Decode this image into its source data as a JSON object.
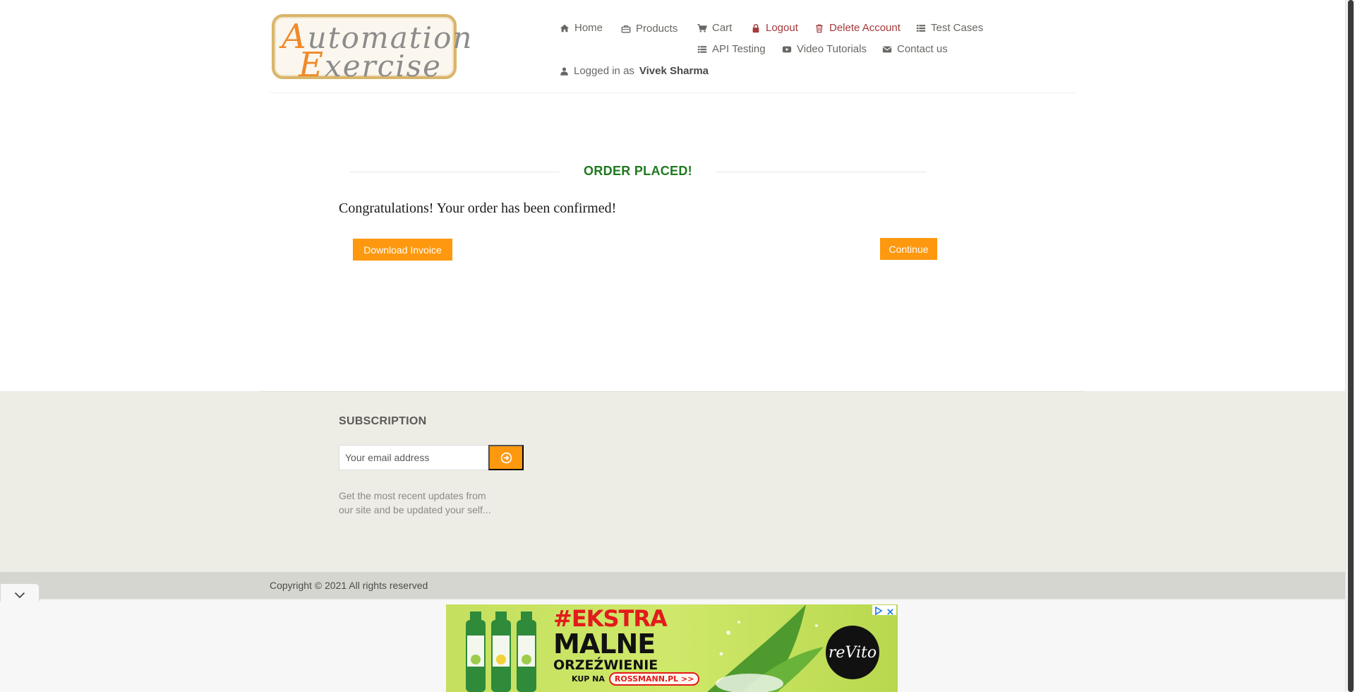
{
  "logo": {
    "line1_cap": "A",
    "line1_rest": "utomation",
    "line2_cap": "E",
    "line2_rest": "xercise"
  },
  "nav": {
    "home": "Home",
    "products": "Products",
    "cart": "Cart",
    "logout": "Logout",
    "delete_account": "Delete Account",
    "test_cases": "Test Cases",
    "api_testing": "API Testing",
    "video_tutorials": "Video Tutorials",
    "contact_us": "Contact us",
    "logged_in_prefix": "Logged in as",
    "logged_in_user": "Vivek Sharma"
  },
  "order": {
    "title": "ORDER PLACED!",
    "message": "Congratulations! Your order has been confirmed!",
    "download_invoice": "Download Invoice",
    "continue": "Continue"
  },
  "subscription": {
    "title": "SUBSCRIPTION",
    "email_placeholder": "Your email address",
    "description": "Get the most recent updates from our site and be updated your self..."
  },
  "footer": {
    "copyright": "Copyright © 2021 All rights reserved"
  },
  "ad": {
    "headline_1": "#EKSTRA",
    "headline_2": "MALNE",
    "headline_3": "ORZEŹWIENIE",
    "cta_prefix": "KUP NA",
    "cta_link": "ROSSMANN.PL >>",
    "brand": "reVito"
  },
  "colors": {
    "accent": "#fe980f",
    "order_title": "#1f7a1f",
    "danger_link": "#a43a3a",
    "footer_bg": "#edece5"
  },
  "icons": {
    "home": "home-icon",
    "products": "briefcase-icon",
    "cart": "shopping-cart-icon",
    "logout": "lock-icon",
    "delete_account": "trash-icon",
    "test_cases": "list-icon",
    "api_testing": "list-icon",
    "video_tutorials": "youtube-play-icon",
    "contact_us": "envelope-icon",
    "user": "user-icon",
    "subscribe": "arrow-circle-right-icon"
  }
}
